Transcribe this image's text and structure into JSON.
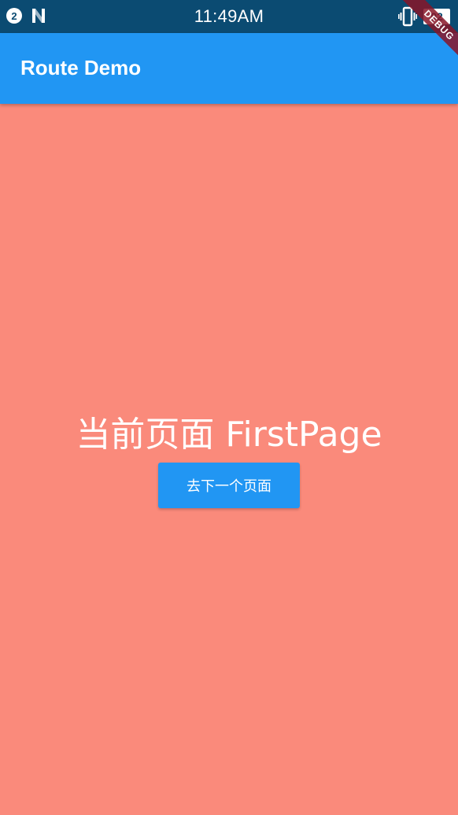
{
  "status_bar": {
    "notification_count": "2",
    "time": "11:49AM",
    "battery": "92",
    "icons": [
      "notification-count-icon",
      "n-app-icon",
      "vibrate-icon",
      "battery-icon"
    ],
    "background_color": "#0b4b72"
  },
  "app_bar": {
    "title": "Route Demo",
    "background_color": "#2196f3",
    "debug_banner": "DEBUG"
  },
  "main": {
    "heading": "当前页面 FirstPage",
    "button_label": "去下一个页面",
    "background_color": "#fa8a7b"
  }
}
